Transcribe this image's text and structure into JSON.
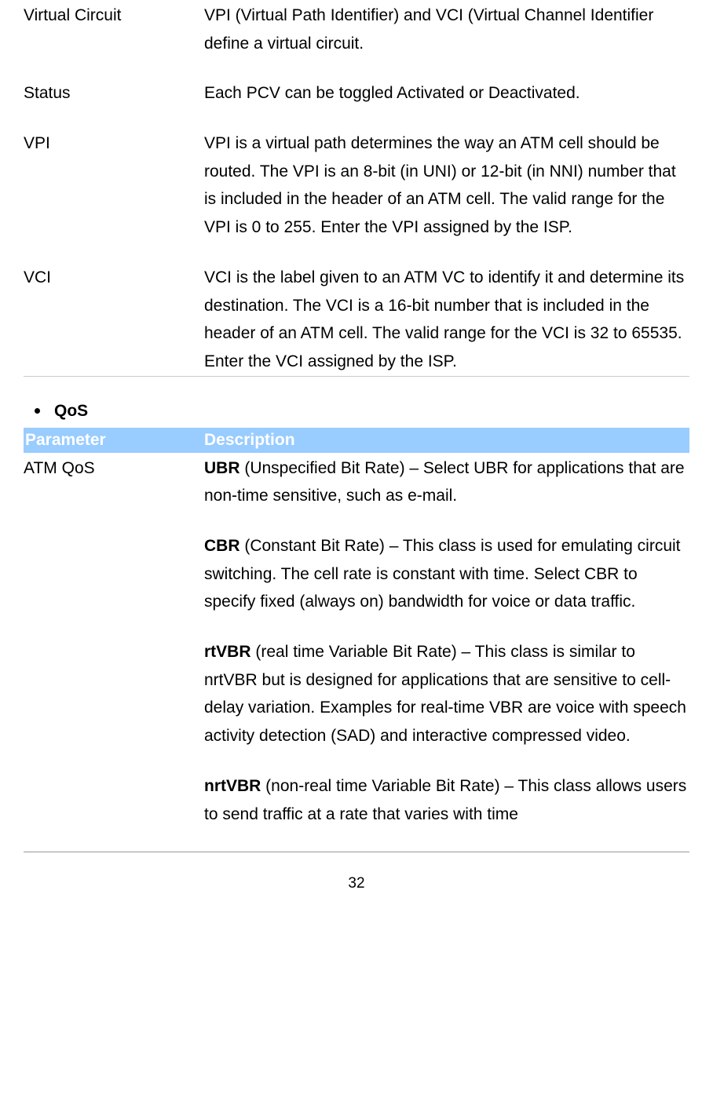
{
  "definitions": [
    {
      "term": "Virtual Circuit",
      "desc": "VPI (Virtual Path Identifier) and VCI (Virtual Channel Identifier define a virtual circuit."
    },
    {
      "term": "Status",
      "desc": "Each PCV can be toggled Activated or Deactivated."
    },
    {
      "term": "VPI",
      "desc": "VPI is a virtual path determines the way an ATM cell should be routed. The VPI is an 8-bit (in UNI) or 12-bit (in NNI) number that is included in the header of an ATM cell. The valid range for the VPI is 0 to 255. Enter the VPI assigned by the ISP."
    },
    {
      "term": "VCI",
      "desc": "VCI is the label given to an ATM VC to identify it and determine its destination. The VCI is a 16-bit number that is included in the header of an ATM cell. The valid range for the VCI is 32 to 65535. Enter the VCI assigned by the ISP."
    }
  ],
  "qos": {
    "heading": "QoS",
    "header": {
      "param": "Parameter",
      "desc": "Description"
    },
    "param_label": "ATM QoS",
    "items": [
      {
        "lead": "UBR",
        "text": " (Unspecified Bit Rate) – Select UBR for applications that are non-time sensitive, such as e-mail."
      },
      {
        "lead": "CBR",
        "text": " (Constant Bit Rate) – This class is used for emulating circuit switching. The cell rate is constant with time. Select CBR to specify fixed (always on) bandwidth for voice or data traffic."
      },
      {
        "lead": "rtVBR",
        "text": " (real time Variable Bit Rate) – This class is similar to nrtVBR but is designed for applications that are sensitive to cell-delay variation. Examples for real-time VBR are voice with speech activity detection (SAD) and interactive compressed video."
      },
      {
        "lead": "nrtVBR",
        "text": " (non-real time Variable Bit Rate) – This class allows users to send traffic at a rate that varies with time"
      }
    ]
  },
  "page_number": "32"
}
